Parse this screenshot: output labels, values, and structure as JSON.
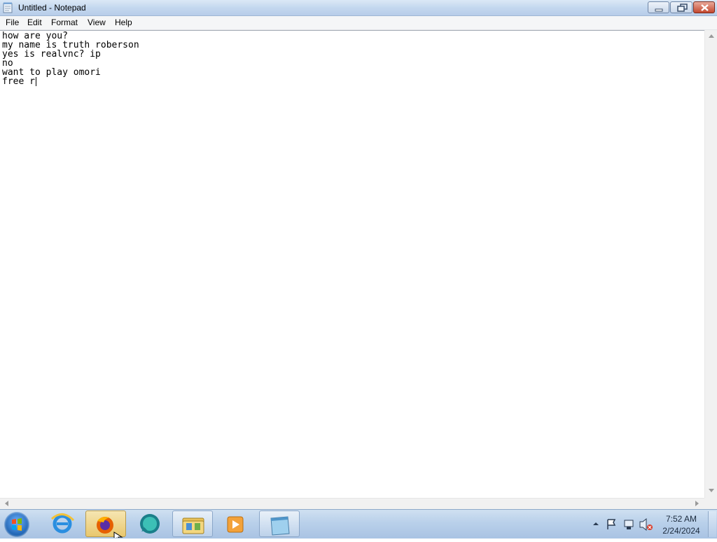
{
  "window": {
    "title": "Untitled - Notepad"
  },
  "menu": [
    "File",
    "Edit",
    "Format",
    "View",
    "Help"
  ],
  "document": {
    "lines": [
      "how are you?",
      "my name is truth roberson",
      "yes is realvnc? ip",
      "no",
      "want to play omori",
      "free r"
    ]
  },
  "taskbar": {
    "icons": [
      "start-orb",
      "internet-explorer-icon",
      "firefox-icon",
      "chat-app-icon",
      "file-explorer-icon",
      "media-player-icon",
      "notepad-icon"
    ],
    "clock": {
      "time": "7:52 AM",
      "date": "2/24/2024"
    }
  },
  "colors": {
    "titlebar": "#c4d8ef",
    "close_button": "#c4482f",
    "taskbar": "#b9d0ea",
    "active_taskbar_button": "#e8c76d"
  }
}
